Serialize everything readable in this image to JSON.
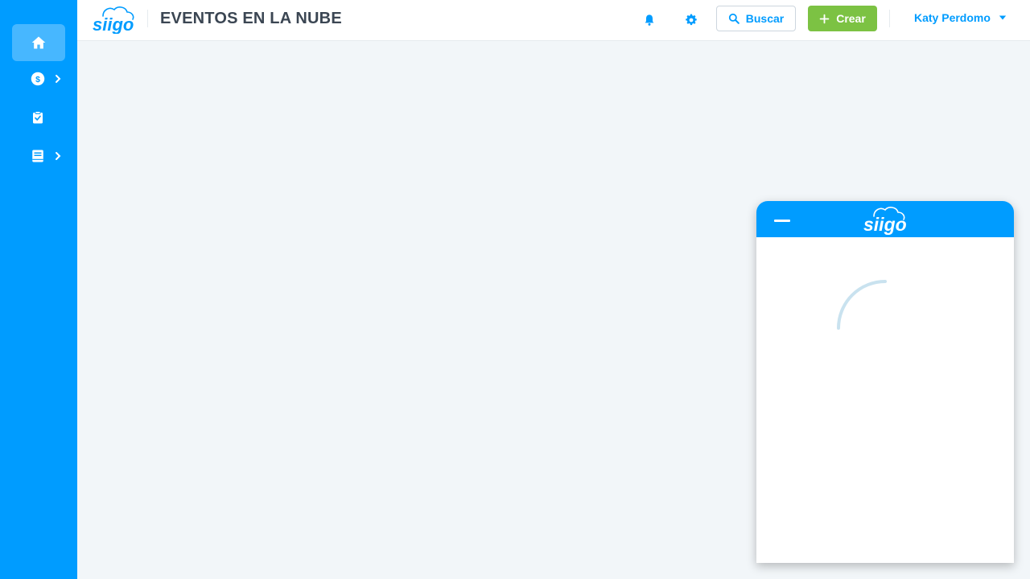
{
  "app": {
    "brand": "Siigo",
    "page_title": "EVENTOS EN LA NUBE",
    "colors": {
      "primary": "#009cff",
      "create_button": "#7cc243",
      "title_text": "#3b4653",
      "background": "#f2f6f9"
    }
  },
  "sidebar": {
    "items": [
      {
        "icon": "home-icon",
        "active": true,
        "has_submenu": false
      },
      {
        "icon": "dollar-circle-icon",
        "active": false,
        "has_submenu": true
      },
      {
        "icon": "clipboard-check-icon",
        "active": false,
        "has_submenu": false
      },
      {
        "icon": "book-icon",
        "active": false,
        "has_submenu": true
      }
    ]
  },
  "header": {
    "notifications_icon": "bell-icon",
    "settings_icon": "gear-icon",
    "search_label": "Buscar",
    "create_label": "Crear",
    "user_name": "Katy Perdomo"
  },
  "chat_widget": {
    "brand": "Siigo",
    "minimize_icon": "minimize-icon",
    "loading": true
  }
}
